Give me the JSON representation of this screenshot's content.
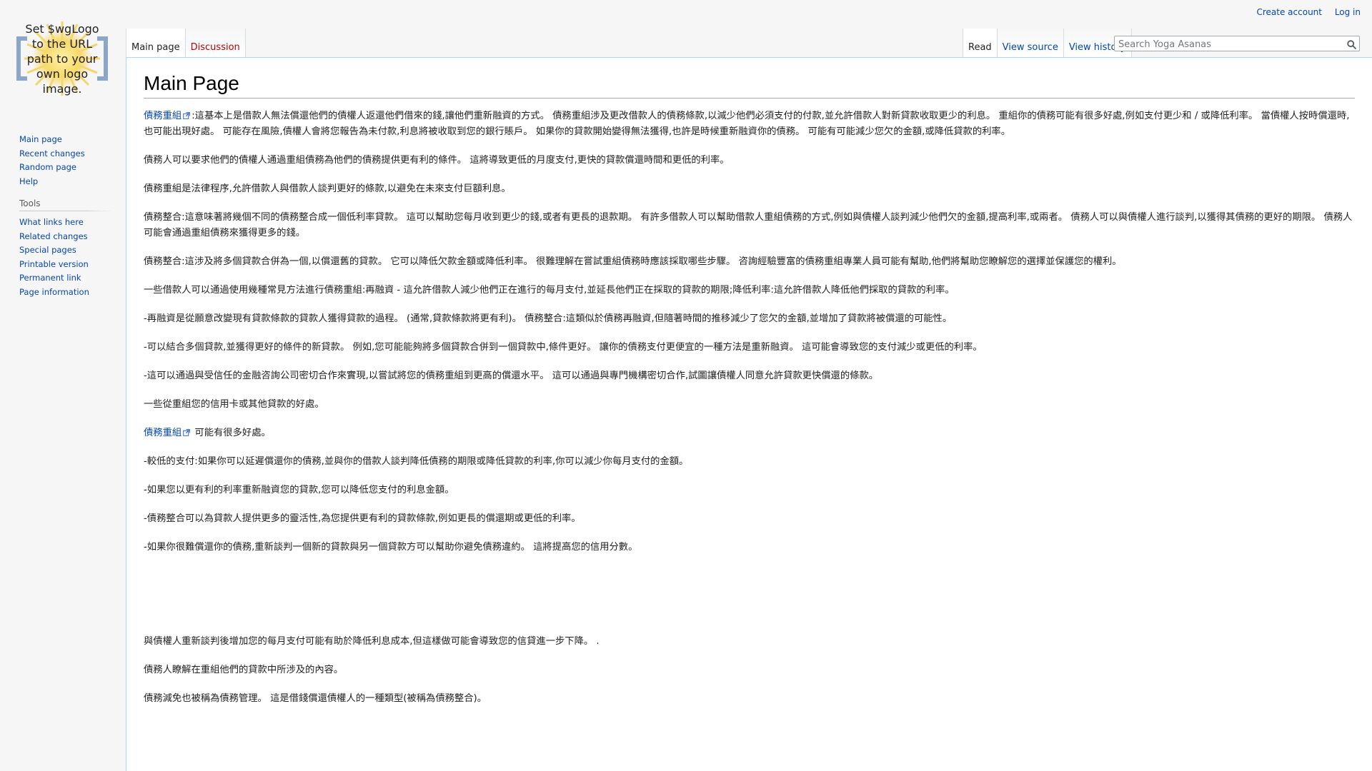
{
  "logo": {
    "text": "Set $wgLogo to the URL path to your own logo image."
  },
  "personal": {
    "create_account": "Create account",
    "log_in": "Log in"
  },
  "navigation": {
    "items": [
      {
        "label": "Main page"
      },
      {
        "label": "Recent changes"
      },
      {
        "label": "Random page"
      },
      {
        "label": "Help"
      }
    ]
  },
  "tools": {
    "heading": "Tools",
    "items": [
      {
        "label": "What links here"
      },
      {
        "label": "Related changes"
      },
      {
        "label": "Special pages"
      },
      {
        "label": "Printable version"
      },
      {
        "label": "Permanent link"
      },
      {
        "label": "Page information"
      }
    ]
  },
  "tabs": {
    "main_page": "Main page",
    "discussion": "Discussion",
    "read": "Read",
    "view_source": "View source",
    "view_history": "View history"
  },
  "search": {
    "placeholder": "Search Yoga Asanas",
    "value": ""
  },
  "page": {
    "title": "Main Page",
    "link_text": "債務重組",
    "paragraphs": [
      ":這基本上是借款人無法償還他們的債權人返還他們借來的錢,讓他們重新融資的方式。 債務重組涉及更改借款人的債務條款,以減少他們必須支付的付款,並允許借款人對新貸款收取更少的利息。 重組你的債務可能有很多好處,例如支付更少和 / 或降低利率。 當債權人按時償還時,也可能出現好處。 可能存在風險,債權人會將您報告為未付款,利息將被收取到您的銀行賬戶。 如果你的貸款開始變得無法獲得,也許是時候重新融資你的債務。 可能有可能減少您欠的金額,或降低貸款的利率。",
      "債務人可以要求他們的債權人通過重組債務為他們的債務提供更有利的條件。 這將導致更低的月度支付,更快的貸款償還時間和更低的利率。",
      "債務重組是法律程序,允許借款人與借款人談判更好的條款,以避免在未來支付巨額利息。",
      "債務整合:這意味著將幾個不同的債務整合成一個低利率貸款。 這可以幫助您每月收到更少的錢,或者有更長的退款期。 有許多借款人可以幫助借款人重組債務的方式,例如與債權人談判減少他們欠的金額,提高利率,或兩者。 債務人可以與債權人進行談判,以獲得其債務的更好的期限。 債務人可能會通過重組債務來獲得更多的錢。",
      "債務整合:這涉及將多個貸款合併為一個,以償還舊的貸款。 它可以降低欠款金額或降低利率。 很難理解在嘗試重組債務時應該採取哪些步驟。 咨詢經驗豐富的債務重組專業人員可能有幫助,他們將幫助您瞭解您的選擇並保護您的權利。",
      "一些借款人可以通過使用幾種常見方法進行債務重組:再融資 - 這允許借款人減少他們正在進行的每月支付,並延長他們正在採取的貸款的期限;降低利率:這允許借款人降低他們採取的貸款的利率。",
      "-再融資是從願意改變現有貸款條款的貸款人獲得貸款的過程。 (通常,貸款條款將更有利)。 債務整合:這類似於債務再融資,但隨著時間的推移減少了您欠的金額,並增加了貸款將被償還的可能性。",
      "-可以結合多個貸款,並獲得更好的條件的新貸款。 例如,您可能能夠將多個貸款合併到一個貸款中,條件更好。 讓你的債務支付更便宜的一種方法是重新融資。 這可能會導致您的支付減少或更低的利率。",
      "-這可以通過與受信任的金融咨詢公司密切合作來實現,以嘗試將您的債務重組到更高的償還水平。 這可以通過與專門機構密切合作,試圖讓債權人同意允許貸款更快償還的條款。",
      "一些從重組您的信用卡或其他貸款的好處。",
      "可能有很多好處。",
      "-較低的支付:如果你可以延遲償還你的債務,並與你的借款人談判降低債務的期限或降低貸款的利率,你可以減少你每月支付的金額。",
      "-如果您以更有利的利率重新融資您的貸款,您可以降低您支付的利息金額。",
      "-債務整合可以為貸款人提供更多的靈活性,為您提供更有利的貸款條款,例如更長的償還期或更低的利率。",
      "-如果你很難償還你的債務,重新談判一個新的貸款與另一個貸款方可以幫助你避免債務違約。 這將提高您的信用分數。",
      "與債權人重新談判後增加您的每月支付可能有助於降低利息成本,但這樣做可能會導致您的信貸進一步下降。 .",
      "債務人瞭解在重組他們的貸款中所涉及的內容。",
      "債務減免也被稱為債務管理。 這是借錢償還債權人的一種類型(被稱為債務整合)。"
    ]
  }
}
